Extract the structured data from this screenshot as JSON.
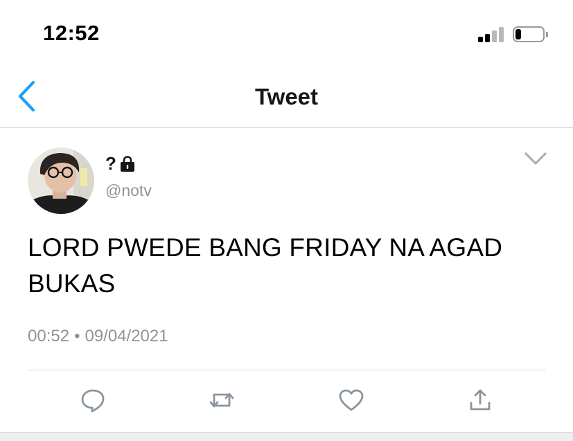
{
  "status_bar": {
    "time": "12:52",
    "signal_bars_active": 2,
    "signal_bars_total": 4,
    "battery_level": 0.22
  },
  "nav": {
    "title": "Tweet",
    "back_icon": "chevron-left-icon"
  },
  "tweet": {
    "display_name": "?",
    "protected_icon": "lock-icon",
    "handle": "@notv",
    "text": "LORD PWEDE BANG FRIDAY NA AGAD BUKAS",
    "time": "00:52",
    "separator": "•",
    "date": "09/04/2021",
    "menu_icon": "chevron-down-icon"
  },
  "actions": [
    {
      "name": "reply",
      "icon": "reply-icon"
    },
    {
      "name": "retweet",
      "icon": "retweet-icon"
    },
    {
      "name": "like",
      "icon": "heart-icon"
    },
    {
      "name": "share",
      "icon": "share-icon"
    }
  ],
  "colors": {
    "accent": "#1da1f2",
    "icon_gray": "#8a959e",
    "text": "#14171a"
  }
}
